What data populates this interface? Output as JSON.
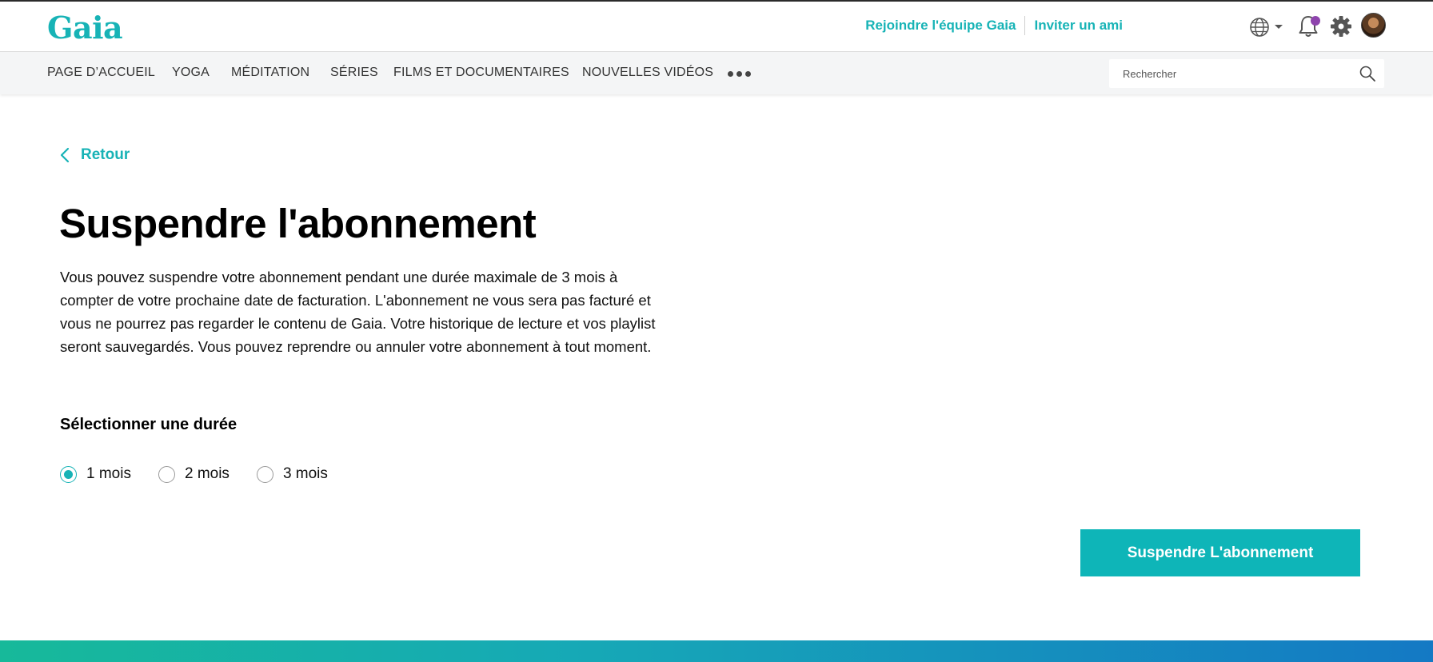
{
  "header": {
    "logo_text": "Gaia",
    "links": {
      "join_team": "Rejoindre l'équipe Gaia",
      "invite_friend": "Inviter un ami"
    },
    "icons": {
      "language": "globe-icon",
      "notifications": "bell-icon",
      "settings": "gear-icon",
      "profile": "avatar"
    }
  },
  "nav": {
    "items": [
      {
        "label": "PAGE D’ACCUEIL"
      },
      {
        "label": "YOGA"
      },
      {
        "label": "MÉDITATION"
      },
      {
        "label": "SÉRIES"
      },
      {
        "label": "FILMS ET DOCUMENTAIRES"
      },
      {
        "label": "NOUVELLES VIDÉOS"
      }
    ],
    "search": {
      "placeholder": "Rechercher",
      "value": ""
    }
  },
  "main": {
    "back_label": "Retour",
    "title": "Suspendre l'abonnement",
    "description": "Vous pouvez suspendre votre abonnement pendant une durée maximale de 3 mois à compter de votre prochaine date de facturation. L'abonnement ne vous sera pas facturé et vous ne pourrez pas regarder le contenu de Gaia. Votre historique de lecture et vos playlist seront sauvegardés. Vous pouvez reprendre ou annuler votre abonnement à tout moment.",
    "duration": {
      "label": "Sélectionner une durée",
      "options": [
        {
          "label": "1 mois",
          "selected": true
        },
        {
          "label": "2 mois",
          "selected": false
        },
        {
          "label": "3 mois",
          "selected": false
        }
      ]
    },
    "submit_label": "Suspendre L'abonnement"
  },
  "colors": {
    "accent": "#17b3b6",
    "notification_dot": "#8e44ad"
  }
}
